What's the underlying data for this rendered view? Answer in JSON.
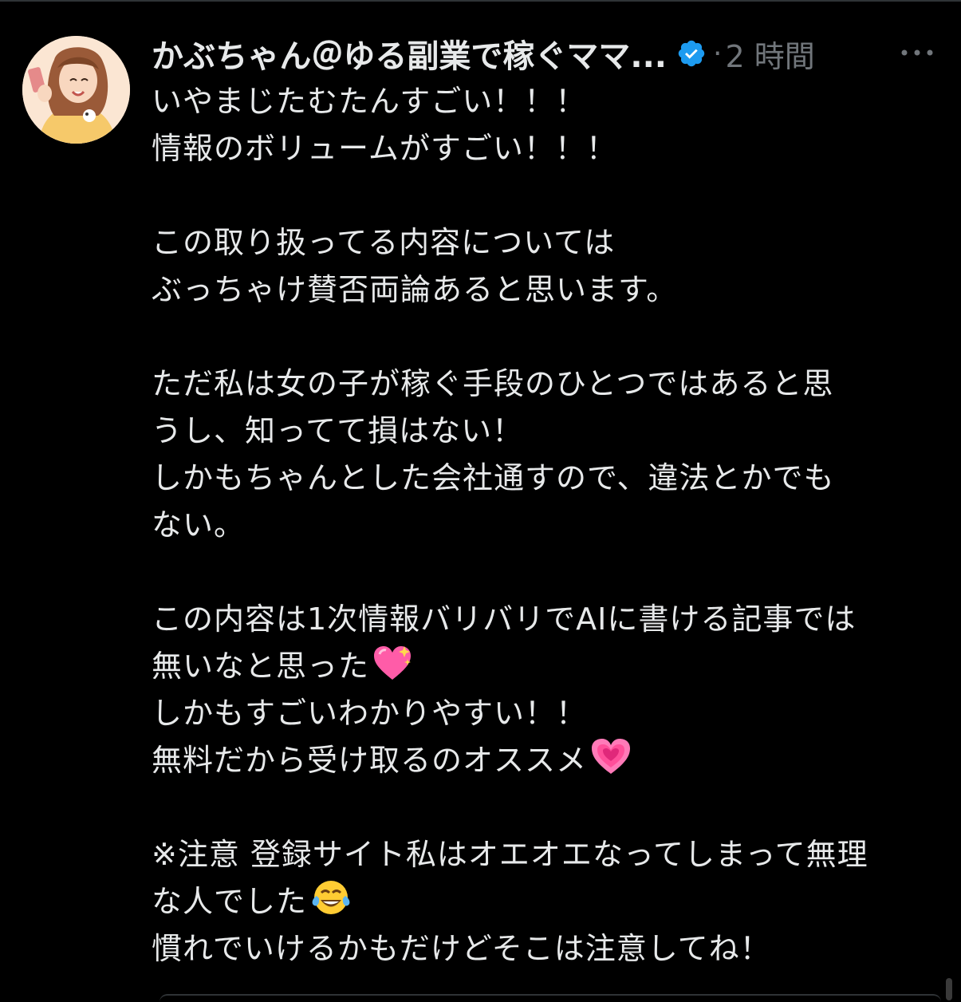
{
  "post": {
    "author": {
      "display_name": "かぶちゃん＠ゆる副業で稼ぐママ...",
      "verified": true,
      "avatar_icon": "avatar-illustration-icon"
    },
    "separator": "·",
    "timestamp": "2 時間",
    "more_icon": "more-dots-icon",
    "body_lines": [
      "いやまじたむたんすごい！！！",
      "情報のボリュームがすごい！！！",
      "",
      "この取り扱ってる内容については",
      "ぶっちゃけ賛否両論あると思います。",
      "",
      "ただ私は女の子が稼ぐ手段のひとつではあると思",
      "うし、知ってて損はない！",
      "しかもちゃんとした会社通すので、違法とかでも",
      "ない。",
      "",
      "この内容は1次情報バリバリでAIに書ける記事では",
      "無いなと思った",
      "しかもすごいわかりやすい！！",
      "無料だから受け取るのオススメ",
      "",
      "※注意 登録サイト私はオエオエなってしまって無理",
      "な人でした",
      "慣れでいけるかもだけどそこは注意してね！"
    ],
    "emojis": {
      "sparkling_heart": "sparkling-heart-emoji",
      "growing_heart": "pink-heart-emoji",
      "tears_of_joy": "tears-of-joy-emoji"
    }
  },
  "colors": {
    "background": "#000000",
    "text_primary": "#e7e9ea",
    "text_secondary": "#71767b",
    "verified_blue": "#1d9bf0"
  }
}
